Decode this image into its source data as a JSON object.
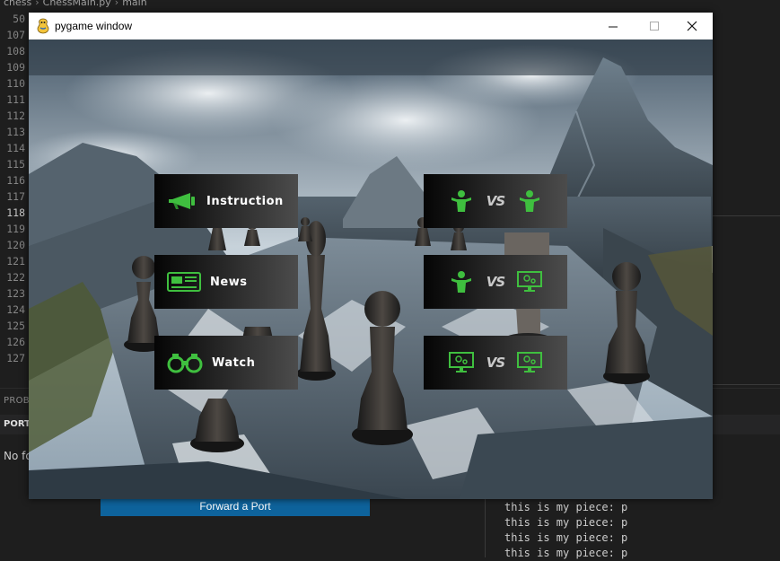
{
  "editor": {
    "breadcrumb": [
      "chess",
      "ChessMain.py",
      "main"
    ],
    "line_numbers": [
      "107",
      "108",
      "109",
      "110",
      "111",
      "112",
      "113",
      "114",
      "115",
      "116",
      "117",
      "118",
      "119",
      "120",
      "121",
      "122",
      "123",
      "124",
      "125",
      "126",
      "127"
    ],
    "first_line": "50",
    "active_line": "118"
  },
  "panel": {
    "problems_tab": "PROB",
    "ports_tab": "PORT",
    "ports_message": "No fo inter",
    "forward_button": "Forward a Port",
    "terminal_lines": [
      "this is my piece: p",
      "this is my piece: p",
      "this is my piece: p",
      "this is my piece: p"
    ]
  },
  "window": {
    "title": "pygame window",
    "controls": [
      "minimize",
      "maximize",
      "close"
    ]
  },
  "menu": {
    "instruction": "Instruction",
    "news": "News",
    "watch": "Watch",
    "vs_label": "VS",
    "modes": [
      {
        "left": "human-icon",
        "right": "human-icon"
      },
      {
        "left": "human-icon",
        "right": "computer-icon"
      },
      {
        "left": "computer-icon",
        "right": "computer-icon"
      }
    ],
    "accent_color": "#3fbf3f"
  }
}
